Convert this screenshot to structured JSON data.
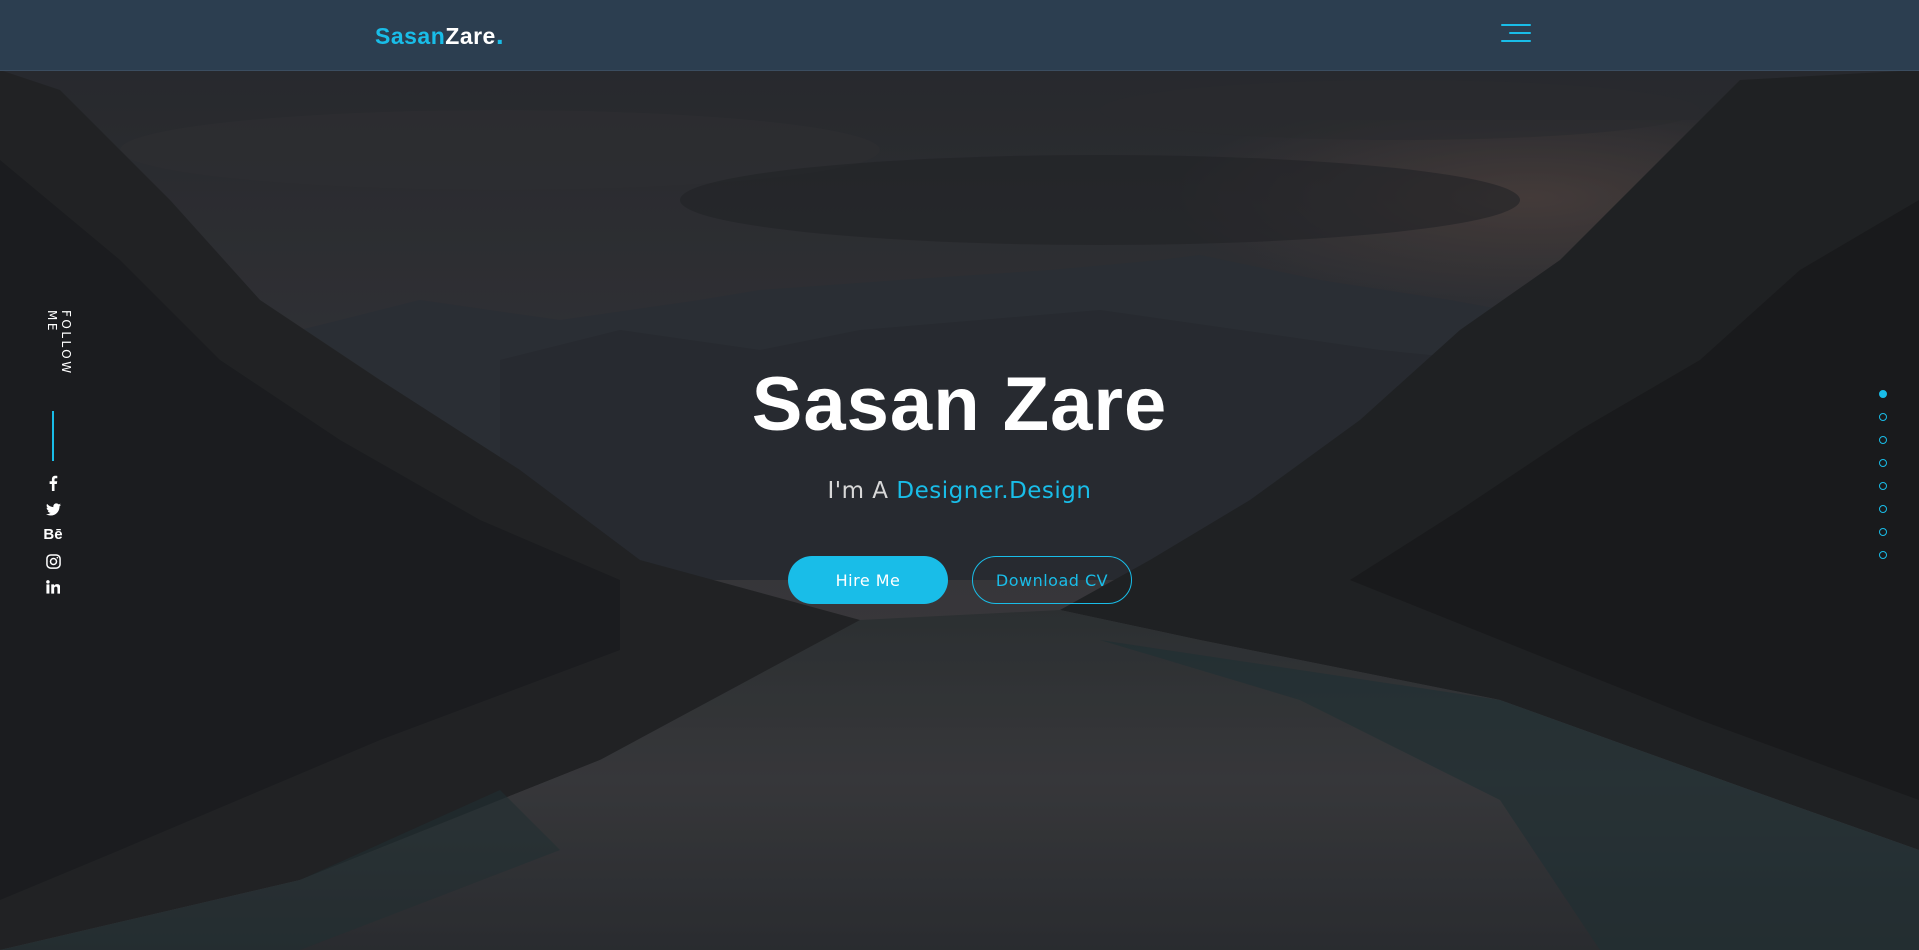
{
  "header": {
    "logo_part1": "Sasan",
    "logo_part2": "Zare",
    "logo_dot": "."
  },
  "hero": {
    "title": "Sasan Zare",
    "subtitle_prefix": "I'm A ",
    "subtitle_typed": "Designer.Design",
    "hire_button": "Hire Me",
    "cv_button": "Download CV"
  },
  "social": {
    "follow_label": "FOLLOW ME",
    "behance_label": "Bē",
    "icons": [
      "facebook-icon",
      "twitter-icon",
      "behance-icon",
      "instagram-icon",
      "linkedin-icon"
    ]
  },
  "colors": {
    "accent": "#19bde8",
    "header_bg": "#2c3e50"
  }
}
